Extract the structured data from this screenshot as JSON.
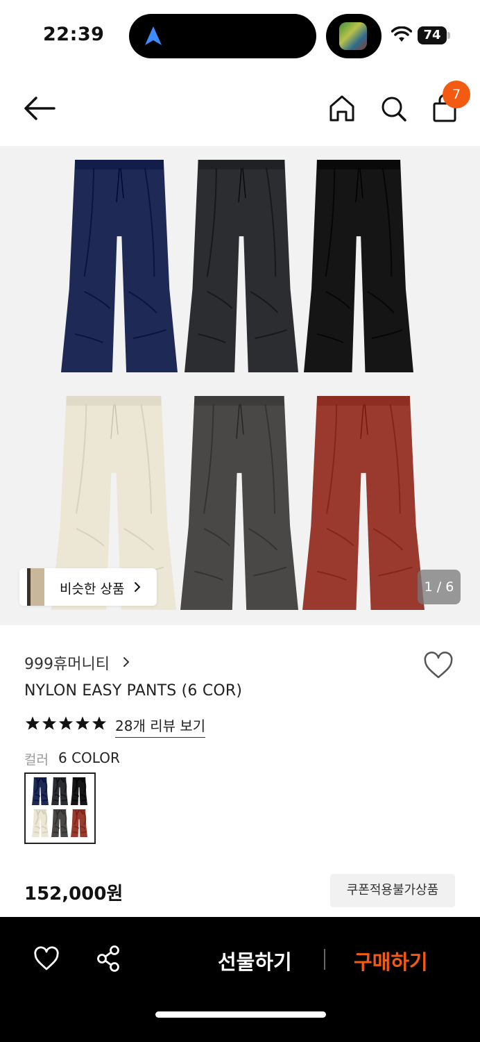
{
  "status_bar": {
    "time": "22:39",
    "battery": "74"
  },
  "header": {
    "back_icon": "arrow-left",
    "home_icon": "house",
    "search_icon": "magnifier",
    "bag_icon": "shopping-bag",
    "bag_badge": "7"
  },
  "gallery": {
    "similar_label": "비슷한 상품",
    "counter": "1 / 6",
    "pant_colors": [
      "#1e2a55",
      "#2c2d31",
      "#151515",
      "#ece6d5",
      "#4a4847",
      "#9a3a2f"
    ]
  },
  "product": {
    "brand": "999휴머니티",
    "name": "NYLON EASY PANTS (6 COR)",
    "reviews": "28개 리뷰 보기",
    "rating_stars": 5,
    "color_label": "컬러",
    "color_value": "6 COLOR",
    "price": "152,000원",
    "coupon": "쿠폰적용불가상품"
  },
  "bottom_bar": {
    "gift": "선물하기",
    "buy": "구매하기",
    "accent": "#f35a12"
  }
}
